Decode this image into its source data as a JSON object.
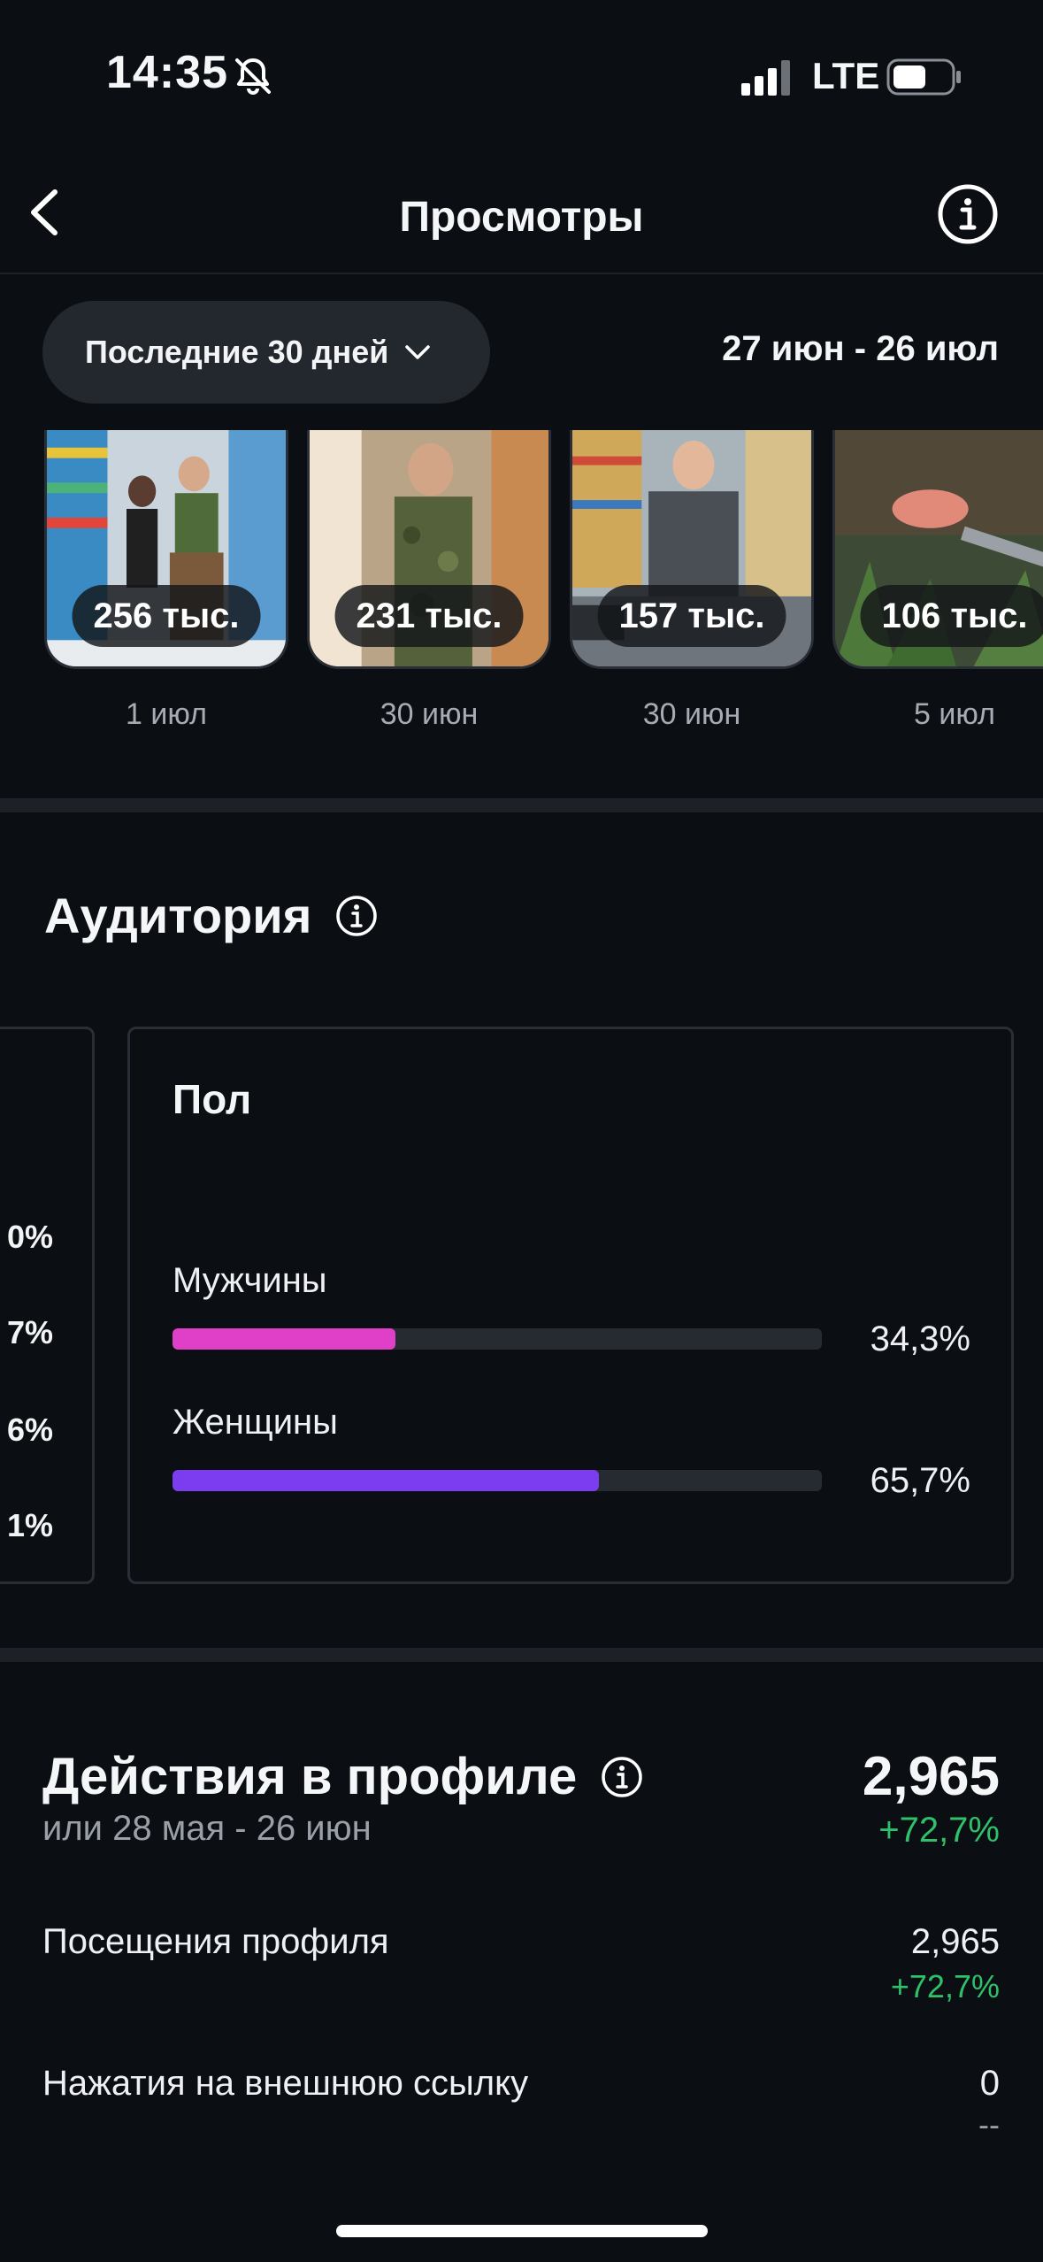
{
  "status_bar": {
    "time": "14:35",
    "network": "LTE",
    "icons": [
      "bell-slash-icon",
      "signal-icon",
      "battery-icon"
    ]
  },
  "nav": {
    "title": "Просмотры",
    "icons": [
      "chevron-left-icon",
      "info-icon"
    ]
  },
  "filter": {
    "range_label": "Последние 30 дней",
    "date_range": "27 июн - 26 июл"
  },
  "thumbnails": [
    {
      "views": "256 тыс.",
      "date": "1 июл"
    },
    {
      "views": "231 тыс.",
      "date": "30 июн"
    },
    {
      "views": "157 тыс.",
      "date": "30 июн"
    },
    {
      "views": "106 тыс.",
      "date": "5 июл"
    }
  ],
  "audience": {
    "title": "Аудитория",
    "age_card_visible_percents": [
      "0%",
      "7%",
      "6%",
      "1%"
    ],
    "gender": {
      "title": "Пол",
      "rows": [
        {
          "label": "Мужчины",
          "value": "34,3%",
          "fraction": 0.343,
          "color": "#e040c8"
        },
        {
          "label": "Женщины",
          "value": "65,7%",
          "fraction": 0.657,
          "color": "#7c3cf0"
        }
      ]
    }
  },
  "profile_actions": {
    "title": "Действия в профиле",
    "subtitle": "или 28 мая - 26 июн",
    "total": "2,965",
    "change": "+72,7%",
    "rows": [
      {
        "label": "Посещения профиля",
        "value": "2,965",
        "change": "+72,7%"
      },
      {
        "label": "Нажатия на внешнюю ссылку",
        "value": "0",
        "change": "--"
      }
    ]
  },
  "colors": {
    "background": "#0b0e13",
    "positive": "#2fc16a",
    "male_bar": "#e040c8",
    "female_bar": "#7c3cf0"
  }
}
